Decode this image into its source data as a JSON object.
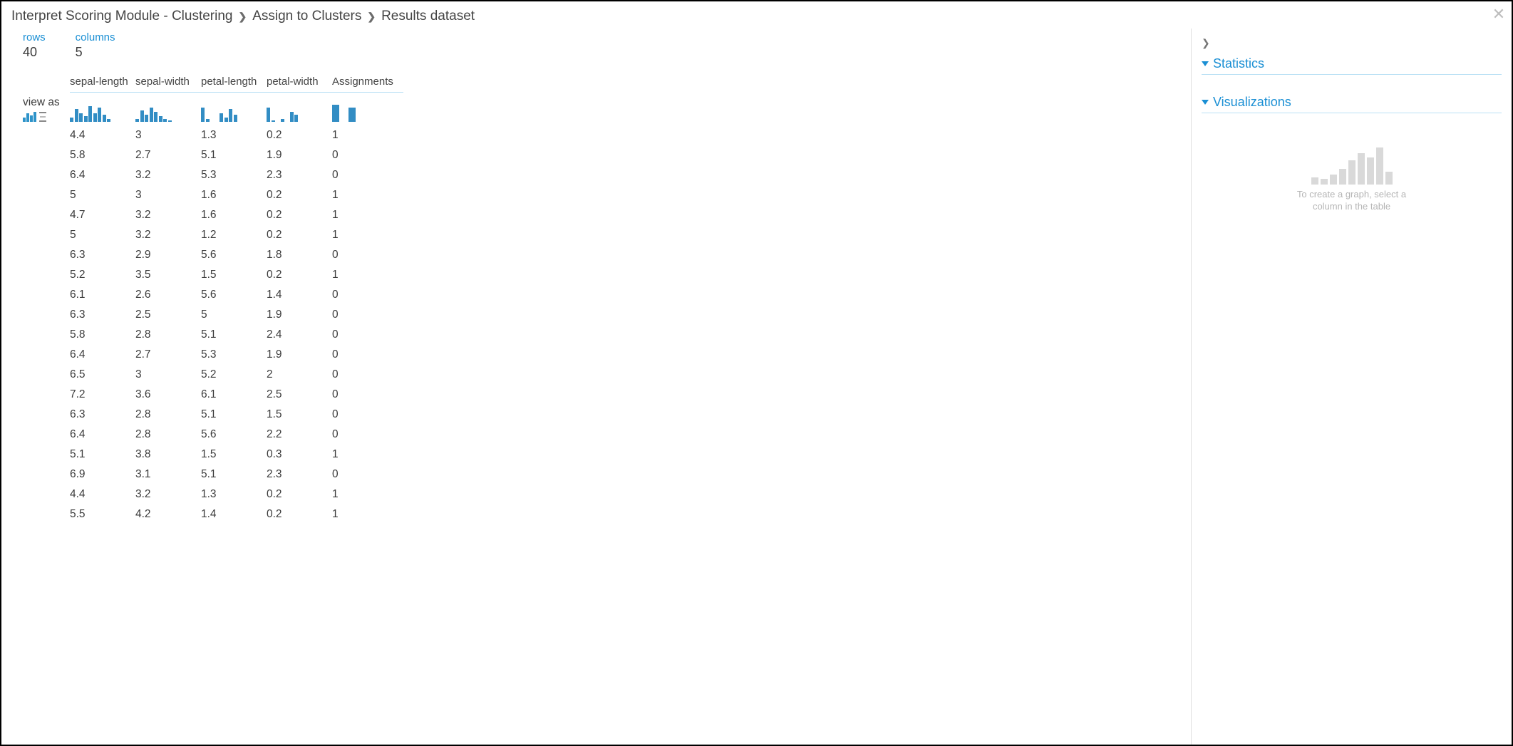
{
  "breadcrumb": {
    "part1": "Interpret Scoring Module - Clustering",
    "part2": "Assign to Clusters",
    "part3": "Results dataset"
  },
  "meta": {
    "rows_label": "rows",
    "rows_value": "40",
    "cols_label": "columns",
    "cols_value": "5"
  },
  "viewas_label": "view as",
  "columns": [
    "sepal-length",
    "sepal-width",
    "petal-length",
    "petal-width",
    "Assignments"
  ],
  "hist_heights": {
    "sepal_length": [
      6,
      18,
      12,
      8,
      22,
      12,
      20,
      10,
      4
    ],
    "sepal_width": [
      4,
      16,
      10,
      20,
      14,
      8,
      4,
      2
    ],
    "petal_length": [
      20,
      4,
      0,
      0,
      12,
      6,
      18,
      10
    ],
    "petal_width": [
      20,
      2,
      0,
      4,
      0,
      14,
      10
    ],
    "assignments": [
      24,
      0,
      20
    ]
  },
  "rows": [
    [
      "4.4",
      "3",
      "1.3",
      "0.2",
      "1"
    ],
    [
      "5.8",
      "2.7",
      "5.1",
      "1.9",
      "0"
    ],
    [
      "6.4",
      "3.2",
      "5.3",
      "2.3",
      "0"
    ],
    [
      "5",
      "3",
      "1.6",
      "0.2",
      "1"
    ],
    [
      "4.7",
      "3.2",
      "1.6",
      "0.2",
      "1"
    ],
    [
      "5",
      "3.2",
      "1.2",
      "0.2",
      "1"
    ],
    [
      "6.3",
      "2.9",
      "5.6",
      "1.8",
      "0"
    ],
    [
      "5.2",
      "3.5",
      "1.5",
      "0.2",
      "1"
    ],
    [
      "6.1",
      "2.6",
      "5.6",
      "1.4",
      "0"
    ],
    [
      "6.3",
      "2.5",
      "5",
      "1.9",
      "0"
    ],
    [
      "5.8",
      "2.8",
      "5.1",
      "2.4",
      "0"
    ],
    [
      "6.4",
      "2.7",
      "5.3",
      "1.9",
      "0"
    ],
    [
      "6.5",
      "3",
      "5.2",
      "2",
      "0"
    ],
    [
      "7.2",
      "3.6",
      "6.1",
      "2.5",
      "0"
    ],
    [
      "6.3",
      "2.8",
      "5.1",
      "1.5",
      "0"
    ],
    [
      "6.4",
      "2.8",
      "5.6",
      "2.2",
      "0"
    ],
    [
      "5.1",
      "3.8",
      "1.5",
      "0.3",
      "1"
    ],
    [
      "6.9",
      "3.1",
      "5.1",
      "2.3",
      "0"
    ],
    [
      "4.4",
      "3.2",
      "1.3",
      "0.2",
      "1"
    ],
    [
      "5.5",
      "4.2",
      "1.4",
      "0.2",
      "1"
    ]
  ],
  "side": {
    "statistics_label": "Statistics",
    "visualizations_label": "Visualizations",
    "hint_line1": "To create a graph, select a",
    "hint_line2": "column in the table"
  },
  "viz_placeholder_heights": [
    10,
    8,
    14,
    22,
    34,
    44,
    38,
    52,
    18
  ]
}
